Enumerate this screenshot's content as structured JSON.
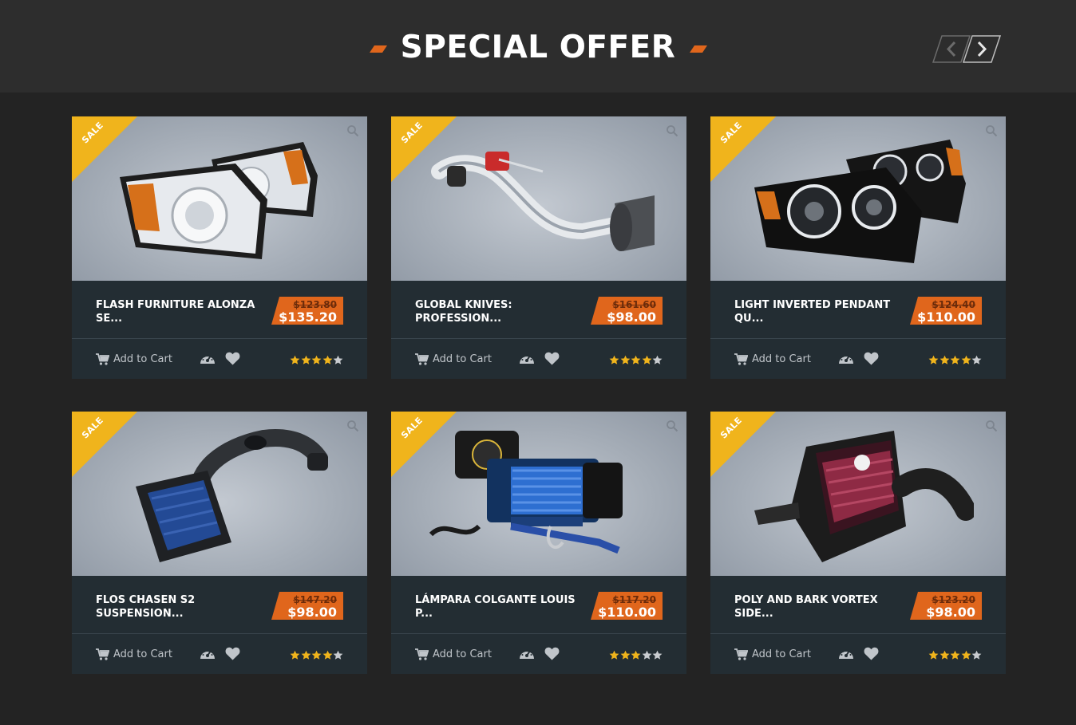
{
  "header": {
    "title": "SPECIAL OFFER",
    "prev_icon": "chevron-left-icon",
    "next_icon": "chevron-right-icon"
  },
  "colors": {
    "accent": "#e0661c",
    "ribbon": "#f0b41c",
    "card": "#232d33",
    "star_on": "#f0b41c",
    "star_off": "#c9ccd0"
  },
  "products": [
    {
      "badge": "SALE",
      "name": "FLASH FURNITURE ALONZA SE...",
      "old_price": "$123.80",
      "price": "$135.20",
      "cart_label": "Add to Cart",
      "rating": 4,
      "art": "headlights-chrome"
    },
    {
      "badge": "SALE",
      "name": "GLOBAL KNIVES: PROFESSION...",
      "old_price": "$161.60",
      "price": "$98.00",
      "cart_label": "Add to Cart",
      "rating": 4,
      "art": "intake-chrome"
    },
    {
      "badge": "SALE",
      "name": "LIGHT INVERTED PENDANT QU...",
      "old_price": "$124.40",
      "price": "$110.00",
      "cart_label": "Add to Cart",
      "rating": 4,
      "art": "headlights-black"
    },
    {
      "badge": "SALE",
      "name": "FLOS CHASEN S2 SUSPENSION...",
      "old_price": "$147.20",
      "price": "$98.00",
      "cart_label": "Add to Cart",
      "rating": 4,
      "art": "intake-blue-filter"
    },
    {
      "badge": "SALE",
      "name": "LÁMPARA COLGANTE LOUIS P...",
      "old_price": "$117.20",
      "price": "$110.00",
      "cart_label": "Add to Cart",
      "rating": 3,
      "art": "winch"
    },
    {
      "badge": "SALE",
      "name": "POLY AND BARK VORTEX SIDE...",
      "old_price": "$123.20",
      "price": "$98.00",
      "cart_label": "Add to Cart",
      "rating": 4,
      "art": "intake-black-box"
    }
  ]
}
